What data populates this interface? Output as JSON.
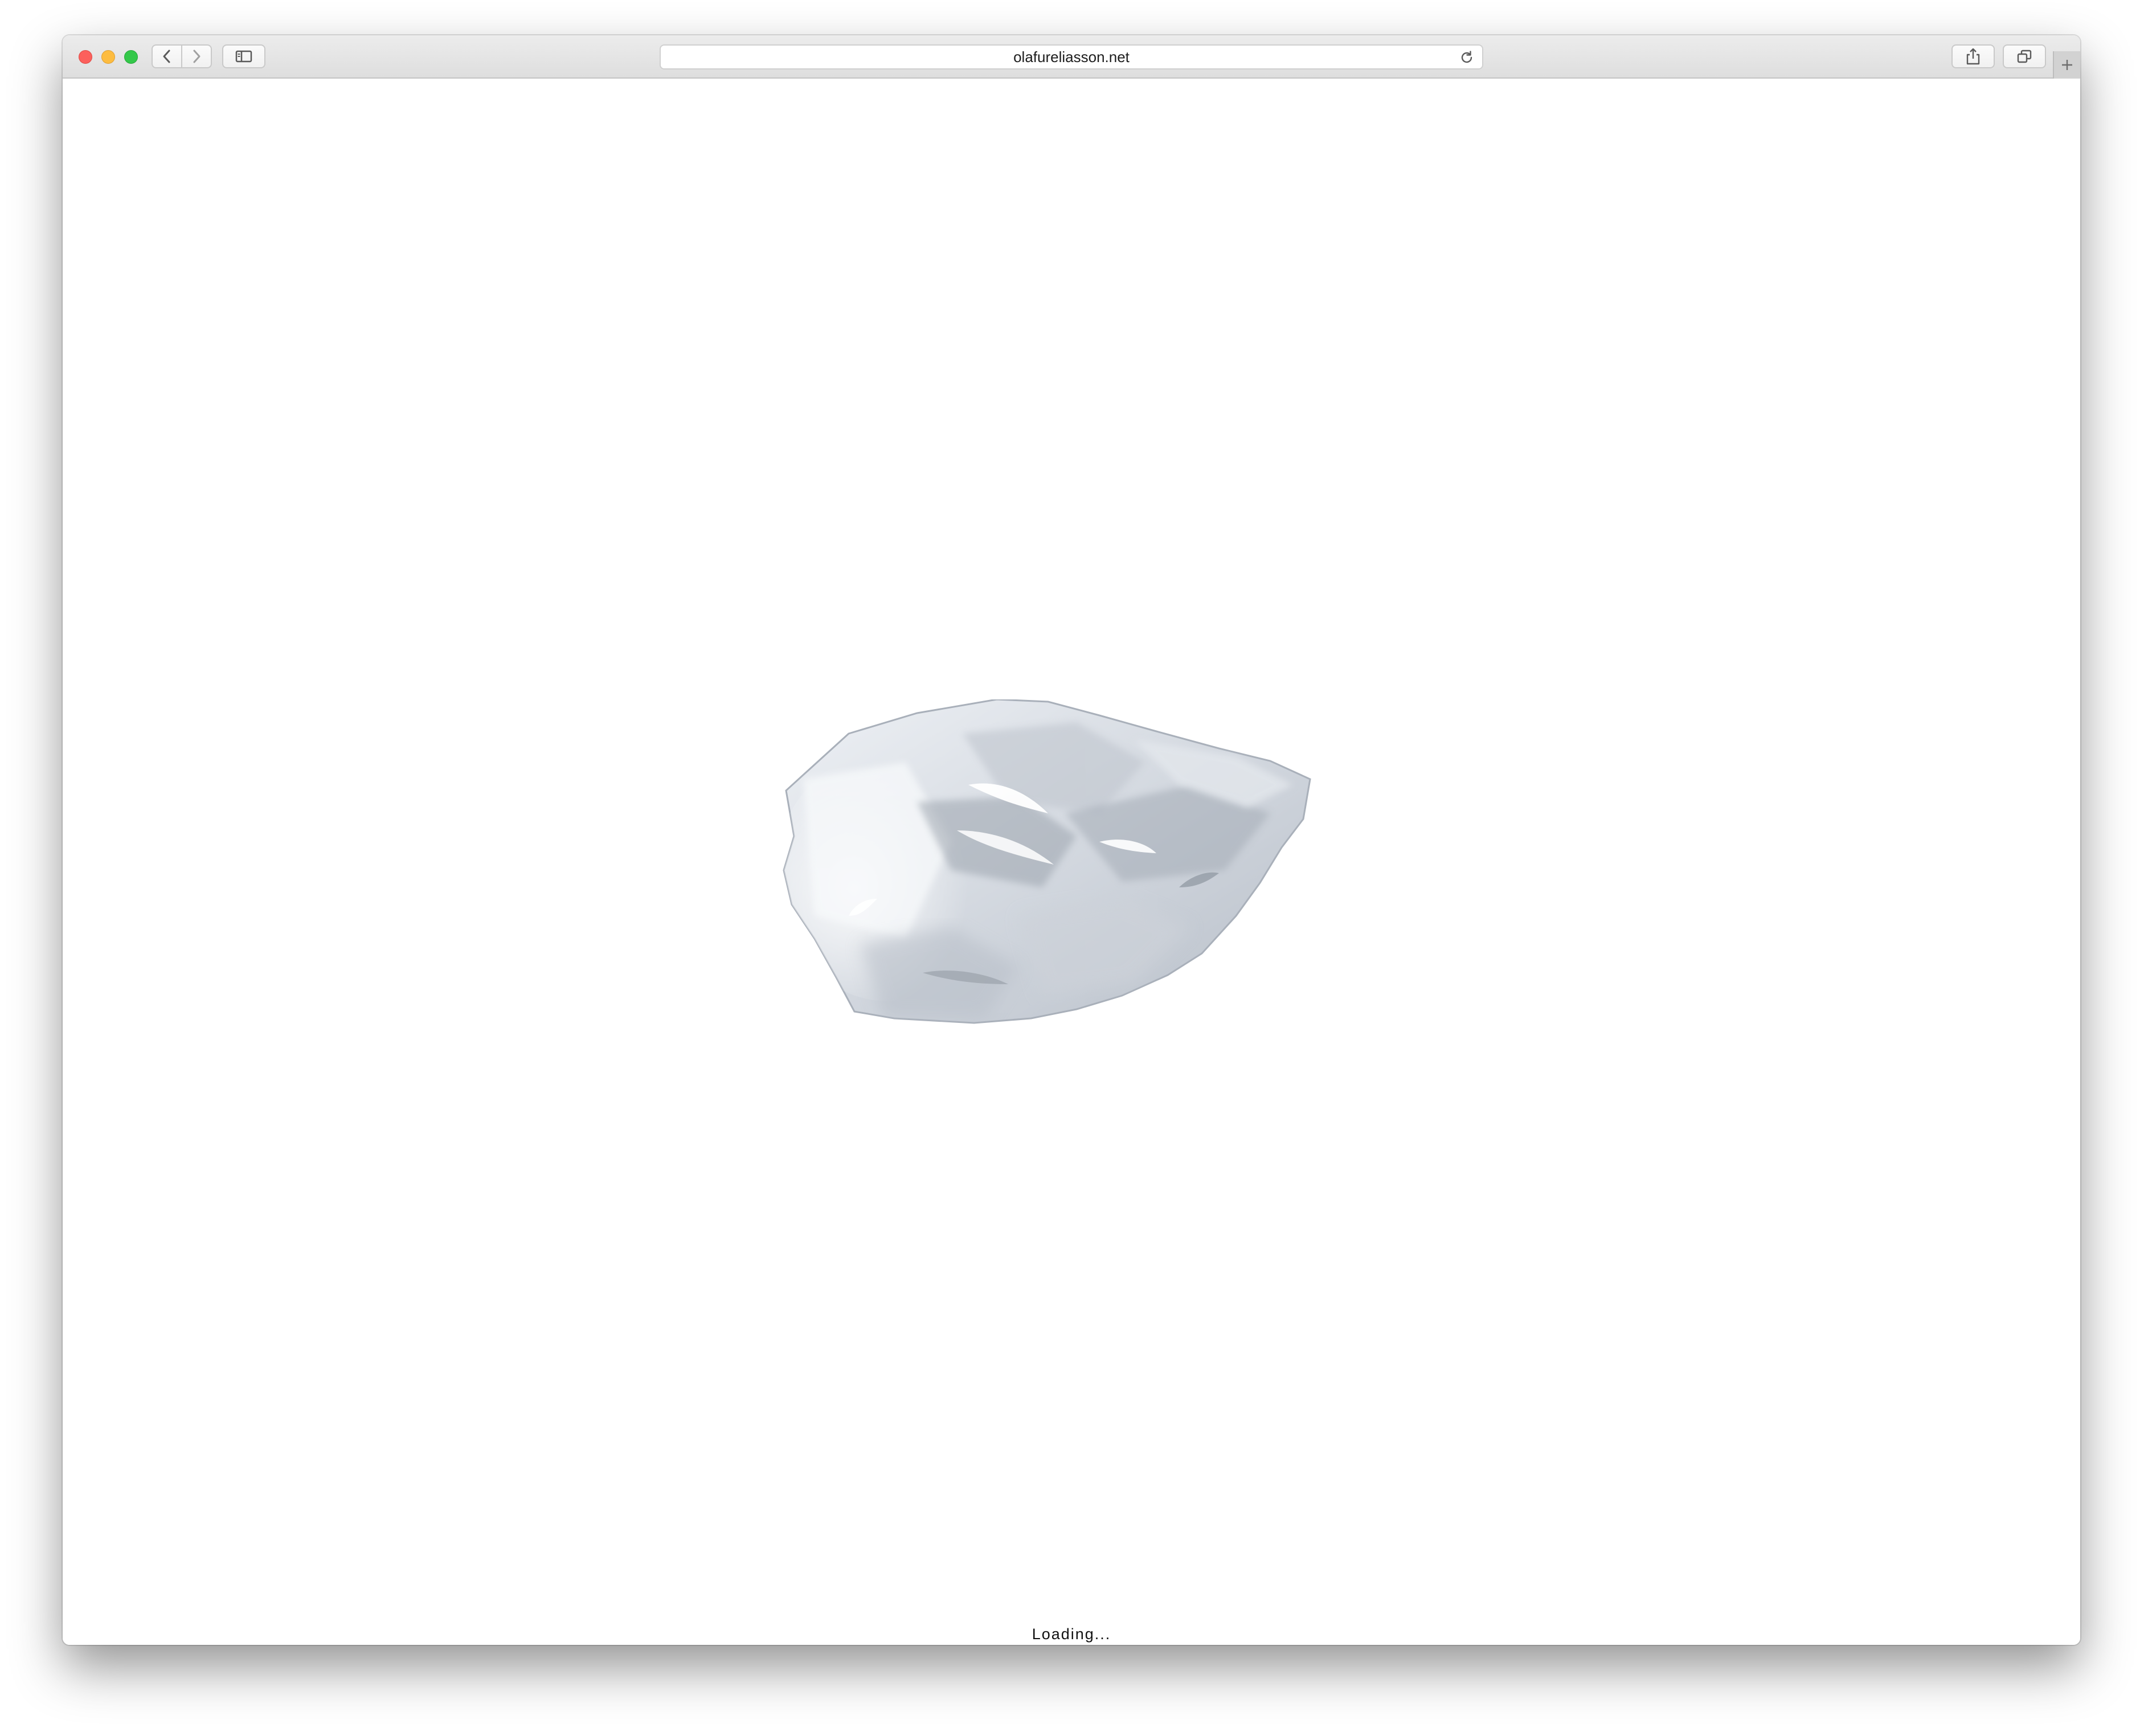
{
  "browser": {
    "address": "olafureliasson.net",
    "icons": {
      "back": "chevron-left-icon",
      "forward": "chevron-right-icon",
      "sidebar": "sidebar-icon",
      "reload": "reload-icon",
      "share": "share-icon",
      "tabs": "tabs-icon",
      "new_tab": "plus-icon"
    }
  },
  "page": {
    "status_text": "Loading...",
    "image": "ice-block"
  },
  "colors": {
    "traffic_close": "#fc605c",
    "traffic_minimize": "#fdbc40",
    "traffic_maximize": "#34c84a",
    "page_background": "#ffffff"
  }
}
